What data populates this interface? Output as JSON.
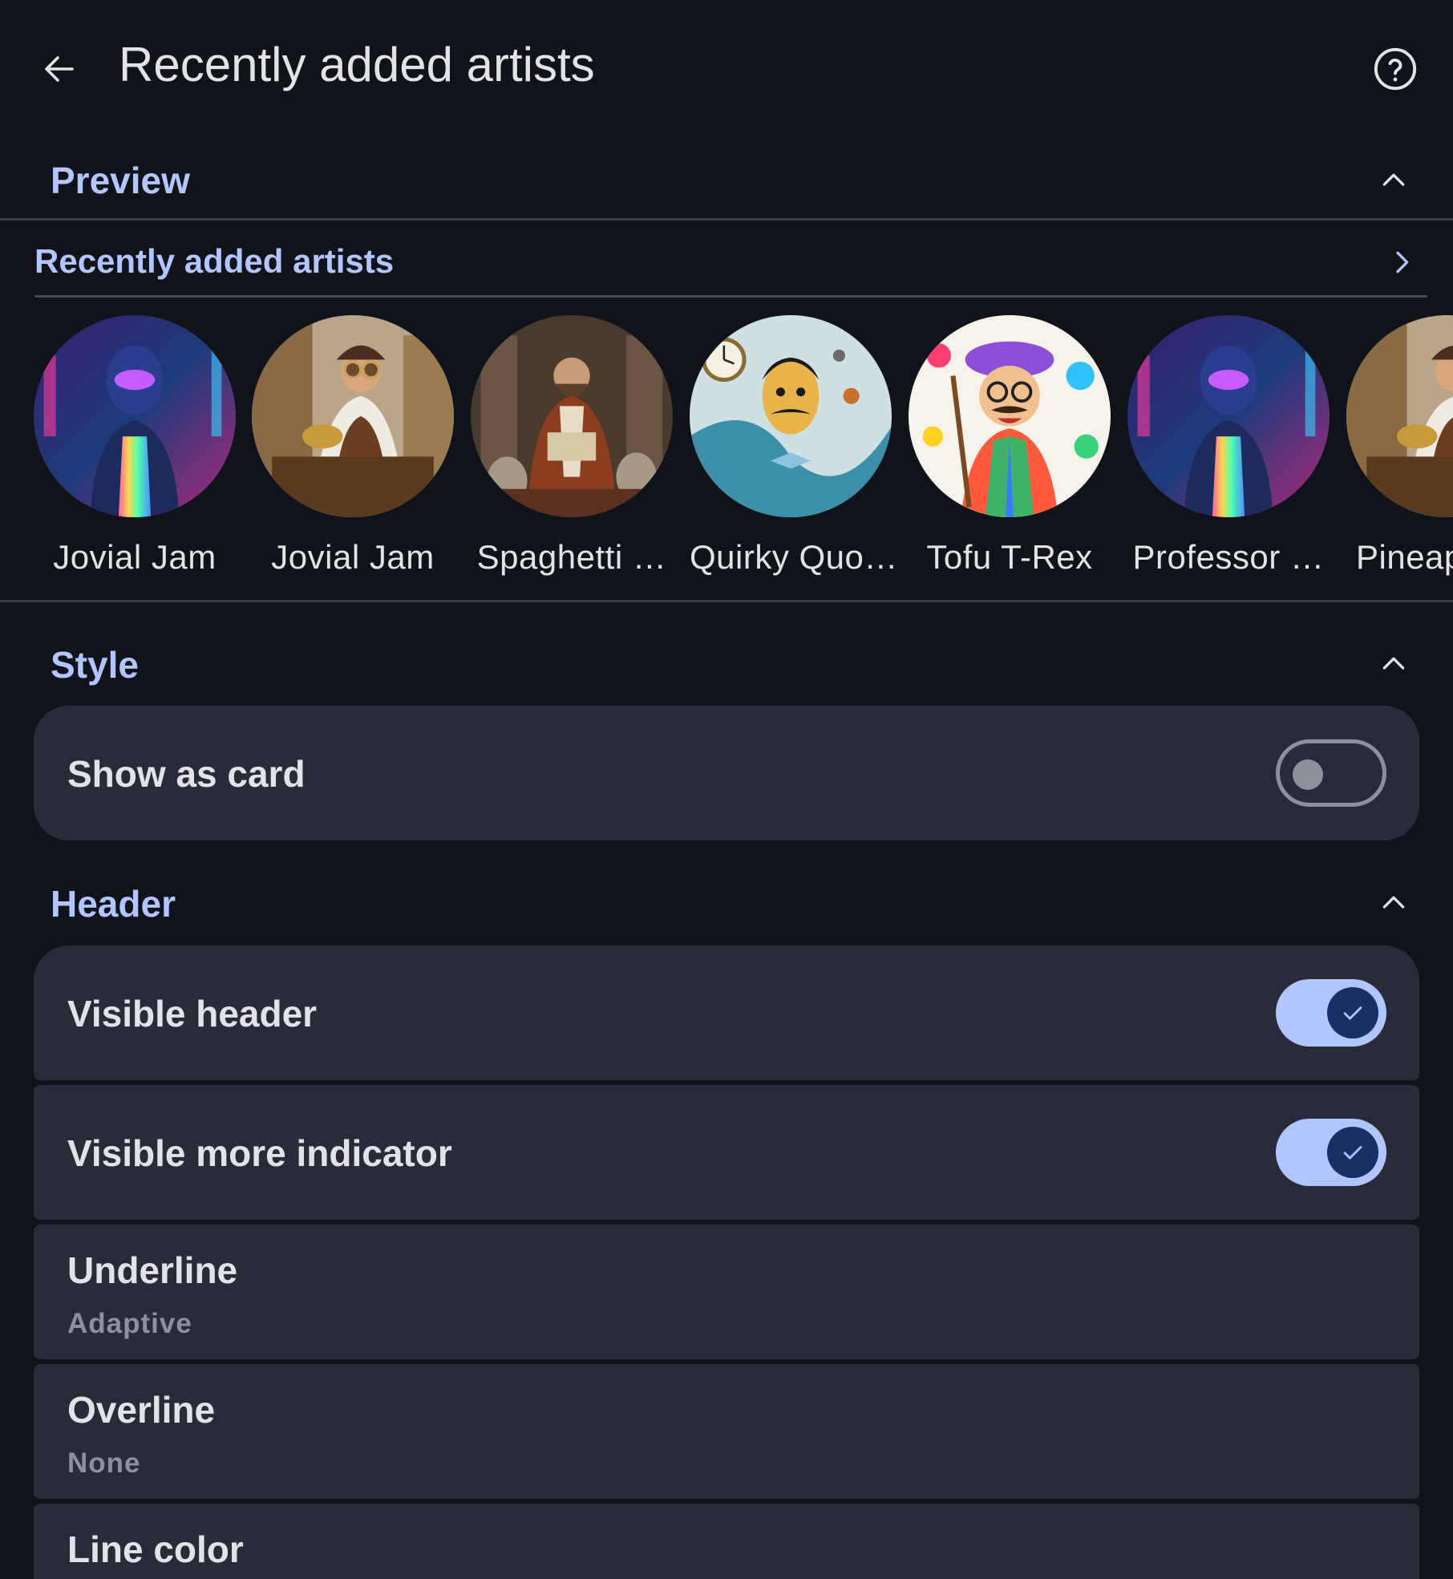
{
  "app_bar": {
    "title": "Recently added artists",
    "back_icon": "arrow-back-icon",
    "help_icon": "help-circle-icon"
  },
  "preview": {
    "section_title": "Preview",
    "header_title": "Recently added artists",
    "artists": [
      {
        "name": "Jovial Jam"
      },
      {
        "name": "Jovial Jam"
      },
      {
        "name": "Spaghetti …"
      },
      {
        "name": "Quirky Quo…"
      },
      {
        "name": "Tofu T-Rex"
      },
      {
        "name": "Professor …"
      },
      {
        "name": "Pineap"
      }
    ]
  },
  "style": {
    "section_title": "Style",
    "show_as_card": {
      "label": "Show as card",
      "checked": false
    }
  },
  "header": {
    "section_title": "Header",
    "visible_header": {
      "label": "Visible header",
      "checked": true
    },
    "visible_more_indicator": {
      "label": "Visible more indicator",
      "checked": true
    },
    "underline": {
      "label": "Underline",
      "value": "Adaptive"
    },
    "overline": {
      "label": "Overline",
      "value": "None"
    },
    "line_color": {
      "label": "Line color"
    }
  },
  "colors": {
    "background": "#11131a",
    "accent": "#b1c5ff",
    "card": "#282c39",
    "text": "#e3e2e8",
    "secondary_text": "#8e909c"
  }
}
